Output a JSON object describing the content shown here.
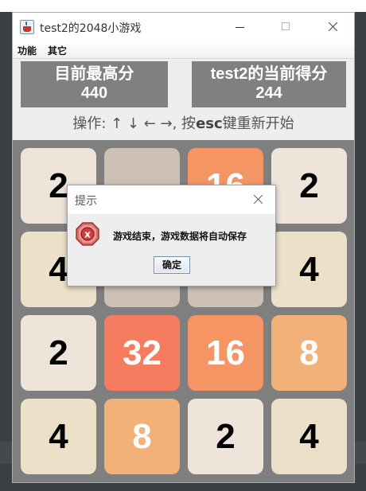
{
  "window": {
    "title": "test2的2048小游戏"
  },
  "menu": [
    "功能",
    "其它"
  ],
  "scores": {
    "best_label": "目前最高分",
    "best_value": "440",
    "current_label": "test2的当前得分",
    "current_value": "244"
  },
  "instructions": {
    "prefix": "操作: ↑ ↓ ← →, 按",
    "key": "esc",
    "suffix": "键重新开始"
  },
  "board": [
    [
      "2",
      "",
      "16",
      "2"
    ],
    [
      "4",
      "",
      "",
      "4"
    ],
    [
      "2",
      "32",
      "16",
      "8"
    ],
    [
      "4",
      "8",
      "2",
      "4"
    ]
  ],
  "tile_colors": {
    "empty": {
      "bg": "#cdc1b4",
      "fg": "#000000"
    },
    "2": {
      "bg": "#eee4da",
      "fg": "#000000"
    },
    "4": {
      "bg": "#ede0c8",
      "fg": "#000000"
    },
    "8": {
      "bg": "#f2b179",
      "fg": "#ffffff"
    },
    "16": {
      "bg": "#f59563",
      "fg": "#ffffff"
    },
    "32": {
      "bg": "#f67c5f",
      "fg": "#ffffff"
    }
  },
  "dialog": {
    "title": "提示",
    "icon": "error-icon",
    "message": "游戏结束，游戏数据将自动保存",
    "ok_label": "确定"
  }
}
